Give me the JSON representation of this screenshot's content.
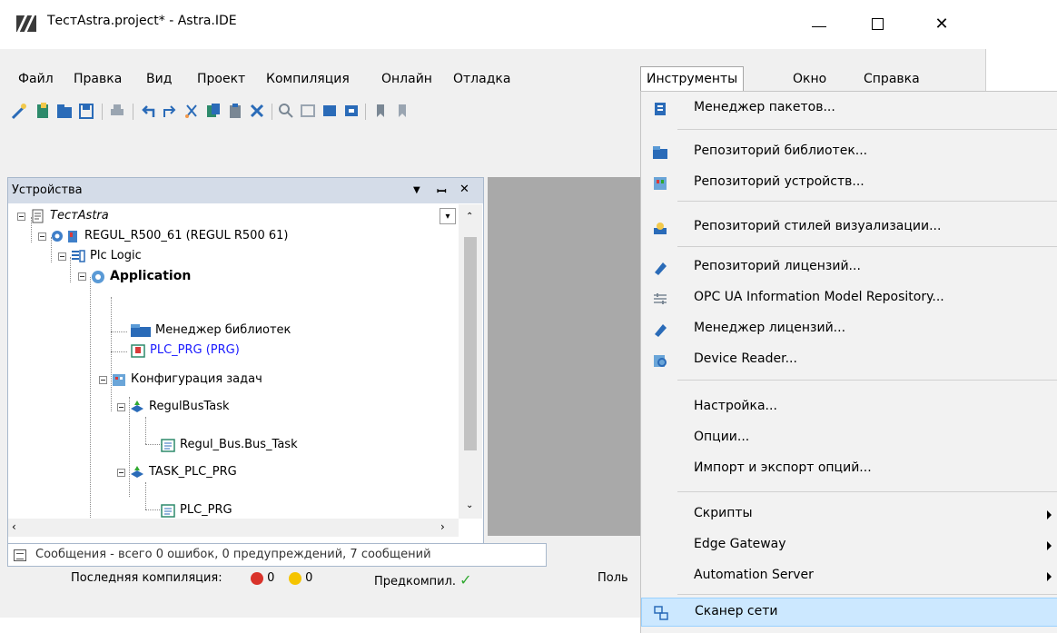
{
  "window": {
    "title": "ТестAstra.project* - Astra.IDE",
    "minimize": "—",
    "maximize": "",
    "close": "✕"
  },
  "menu": {
    "items": [
      "Файл",
      "Правка",
      "Вид",
      "Проект",
      "Компиляция",
      "Онлайн",
      "Отладка",
      "Инструменты",
      "Окно",
      "Справка"
    ],
    "open_item": "Инструменты"
  },
  "devices_panel": {
    "title": "Устройства",
    "dropdown_btn": "▾",
    "pin_btn": "ᵩ",
    "close_btn": "✕",
    "tree": [
      {
        "label": "ТестAstra",
        "italic": true
      },
      {
        "label": "REGUL_R500_61 (REGUL R500 61)"
      },
      {
        "label": "Plc Logic"
      },
      {
        "label": "Application",
        "bold": true
      },
      {
        "label": "Менеджер библиотек"
      },
      {
        "label": "PLC_PRG (PRG)",
        "color": "#1a1aff"
      },
      {
        "label": "Конфигурация задач"
      },
      {
        "label": "RegulBusTask"
      },
      {
        "label": "Regul_Bus.Bus_Task"
      },
      {
        "label": "TASK_PLC_PRG"
      },
      {
        "label": "PLC_PRG"
      }
    ]
  },
  "messages": {
    "text": "Сообщения - всего 0 ошибок, 0 предупреждений, 7 сообщений"
  },
  "statusbar": {
    "last_compile_label": "Последняя компиляция:",
    "errors": "0",
    "warnings": "0",
    "precompile_label": "Предкомпил.",
    "user_prefix": "Поль",
    "error_color": "#d9332b",
    "warning_color": "#f5c400",
    "ok_color": "#2fa82f"
  },
  "tools_menu": {
    "items": [
      {
        "label": "Менеджер пакетов...",
        "icon": "package-manager-icon"
      },
      {
        "label": "Репозиторий библиотек...",
        "icon": "library-repository-icon"
      },
      {
        "label": "Репозиторий устройств...",
        "icon": "device-repository-icon"
      },
      {
        "label": "Репозиторий стилей визуализации...",
        "icon": "visualization-style-icon"
      },
      {
        "label": "Репозиторий лицензий...",
        "icon": "license-repository-icon"
      },
      {
        "label": "OPC UA Information Model Repository...",
        "icon": "opcua-model-icon"
      },
      {
        "label": "Менеджер лицензий...",
        "icon": "license-manager-icon"
      },
      {
        "label": "Device Reader...",
        "icon": "device-reader-icon"
      },
      {
        "label": "Настройка...",
        "icon": ""
      },
      {
        "label": "Опции...",
        "icon": ""
      },
      {
        "label": "Импорт и экспорт опций...",
        "icon": ""
      },
      {
        "label": "Скрипты",
        "icon": "",
        "submenu": true
      },
      {
        "label": "Edge Gateway",
        "icon": "",
        "submenu": true
      },
      {
        "label": "Automation Server",
        "icon": "",
        "submenu": true
      },
      {
        "label": "Сканер сети",
        "icon": "network-scanner-icon",
        "highlighted": true
      }
    ],
    "highlight_color": "#cce8ff"
  }
}
